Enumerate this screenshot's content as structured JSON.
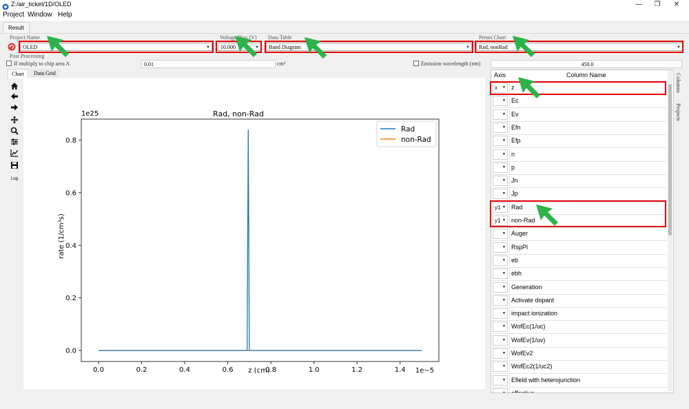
{
  "window": {
    "title": "Z:/air_ticket/1D/OLED",
    "min": "—",
    "max": "❐",
    "close": "✕"
  },
  "menu": [
    "Project",
    "Window",
    "Help"
  ],
  "tabs": {
    "result": "Result"
  },
  "form": {
    "project_name_label": "Project Name",
    "project_name_value": "OLED",
    "voltage_label": "Voltage Bias (V)",
    "voltage_value": "10.000",
    "data_table_label": "Data Table",
    "data_table_value": "Band Diagram",
    "preset_chart_label": "Preset Chart",
    "preset_chart_value": "Rad, nonRad",
    "post_processing_label": "Post Processing",
    "chip_area_label": "If multiply to chip area A",
    "chip_area_value": "0.01",
    "chip_area_unit": "cm²",
    "emission_label": "Emission wavelength (nm)",
    "emission_value": "450.0"
  },
  "subtabs": [
    "Chart",
    "Data Grid"
  ],
  "toolbar": {
    "icons": [
      "home-icon",
      "back-icon",
      "forward-icon",
      "pan-icon",
      "zoom-icon",
      "configure-icon",
      "edit-axes-icon",
      "save-icon"
    ],
    "log_label": "Log"
  },
  "chart_data": {
    "type": "line",
    "title": "Rad, non-Rad",
    "xlabel": "z (cm)",
    "ylabel": "rate (1/cm³s)",
    "x_offset_text": "1e−5",
    "y_offset_text": "1e25",
    "xlim": [
      -0.08,
      1.58
    ],
    "ylim": [
      -0.042,
      0.88
    ],
    "x_ticks": [
      "0.0",
      "0.2",
      "0.4",
      "0.6",
      "0.8",
      "1.0",
      "1.2",
      "1.4"
    ],
    "y_ticks": [
      "0.0",
      "0.2",
      "0.4",
      "0.6",
      "0.8"
    ],
    "legend_position": "top-right",
    "series": [
      {
        "name": "Rad",
        "color": "#1f77b4",
        "x": [
          0.0,
          0.68,
          0.69,
          0.695,
          0.7,
          0.705,
          1.5
        ],
        "y": [
          0.0,
          0.0,
          0.0,
          0.84,
          0.0,
          0.0,
          0.0
        ]
      },
      {
        "name": "non-Rad",
        "color": "#ff7f0e",
        "x": [
          0.0,
          1.5
        ],
        "y": [
          0.0,
          0.0
        ]
      }
    ]
  },
  "column_grid": {
    "axis_header": "Axis",
    "name_header": "Column Name",
    "rows": [
      {
        "axis": "x",
        "name": "z"
      },
      {
        "axis": "",
        "name": "Ec"
      },
      {
        "axis": "",
        "name": "Ev"
      },
      {
        "axis": "",
        "name": "Efn"
      },
      {
        "axis": "",
        "name": "Efp"
      },
      {
        "axis": "",
        "name": "n"
      },
      {
        "axis": "",
        "name": "p"
      },
      {
        "axis": "",
        "name": "Jn"
      },
      {
        "axis": "",
        "name": "Jp"
      },
      {
        "axis": "y1",
        "name": "Rad"
      },
      {
        "axis": "y1",
        "name": "non-Rad"
      },
      {
        "axis": "",
        "name": "Auger"
      },
      {
        "axis": "",
        "name": "RspPl"
      },
      {
        "axis": "",
        "name": "eb"
      },
      {
        "axis": "",
        "name": "ebh"
      },
      {
        "axis": "",
        "name": "Generation"
      },
      {
        "axis": "",
        "name": "Activate dopant"
      },
      {
        "axis": "",
        "name": "impact ionization"
      },
      {
        "axis": "",
        "name": "WofEc(1/uc)"
      },
      {
        "axis": "",
        "name": "WofEv(1/uv)"
      },
      {
        "axis": "",
        "name": "WofEv2"
      },
      {
        "axis": "",
        "name": "WofEc2(1/uc2)"
      },
      {
        "axis": "",
        "name": "Efield with heterojunction"
      },
      {
        "axis": "",
        "name": "effective ..."
      }
    ]
  },
  "side_tabs": [
    "Columns",
    "Projects"
  ],
  "colors": {
    "highlight": "#e00000",
    "pointer_arrow": "#2db34a"
  }
}
